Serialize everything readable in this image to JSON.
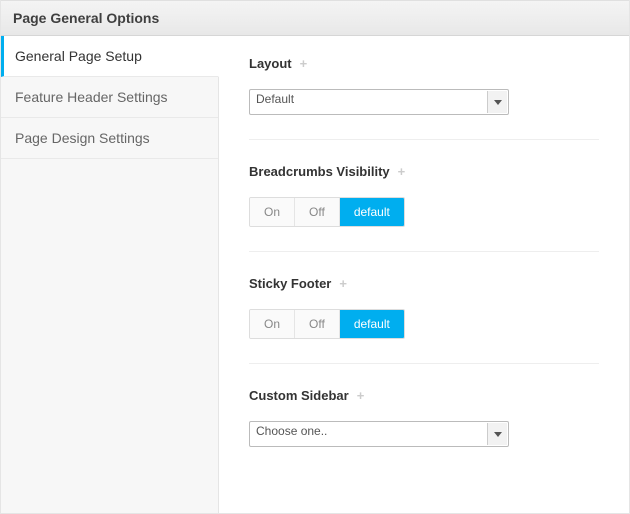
{
  "header": {
    "title": "Page General Options"
  },
  "sidebar": {
    "items": [
      {
        "label": "General Page Setup",
        "active": true
      },
      {
        "label": "Feature Header Settings",
        "active": false
      },
      {
        "label": "Page Design Settings",
        "active": false
      }
    ]
  },
  "sections": {
    "layout": {
      "title": "Layout",
      "selected": "Default"
    },
    "breadcrumbs": {
      "title": "Breadcrumbs Visibility",
      "options": {
        "on": "On",
        "off": "Off",
        "default": "default"
      }
    },
    "sticky_footer": {
      "title": "Sticky Footer",
      "options": {
        "on": "On",
        "off": "Off",
        "default": "default"
      }
    },
    "custom_sidebar": {
      "title": "Custom Sidebar",
      "selected": "Choose one.."
    }
  },
  "colors": {
    "accent": "#00aeef"
  }
}
